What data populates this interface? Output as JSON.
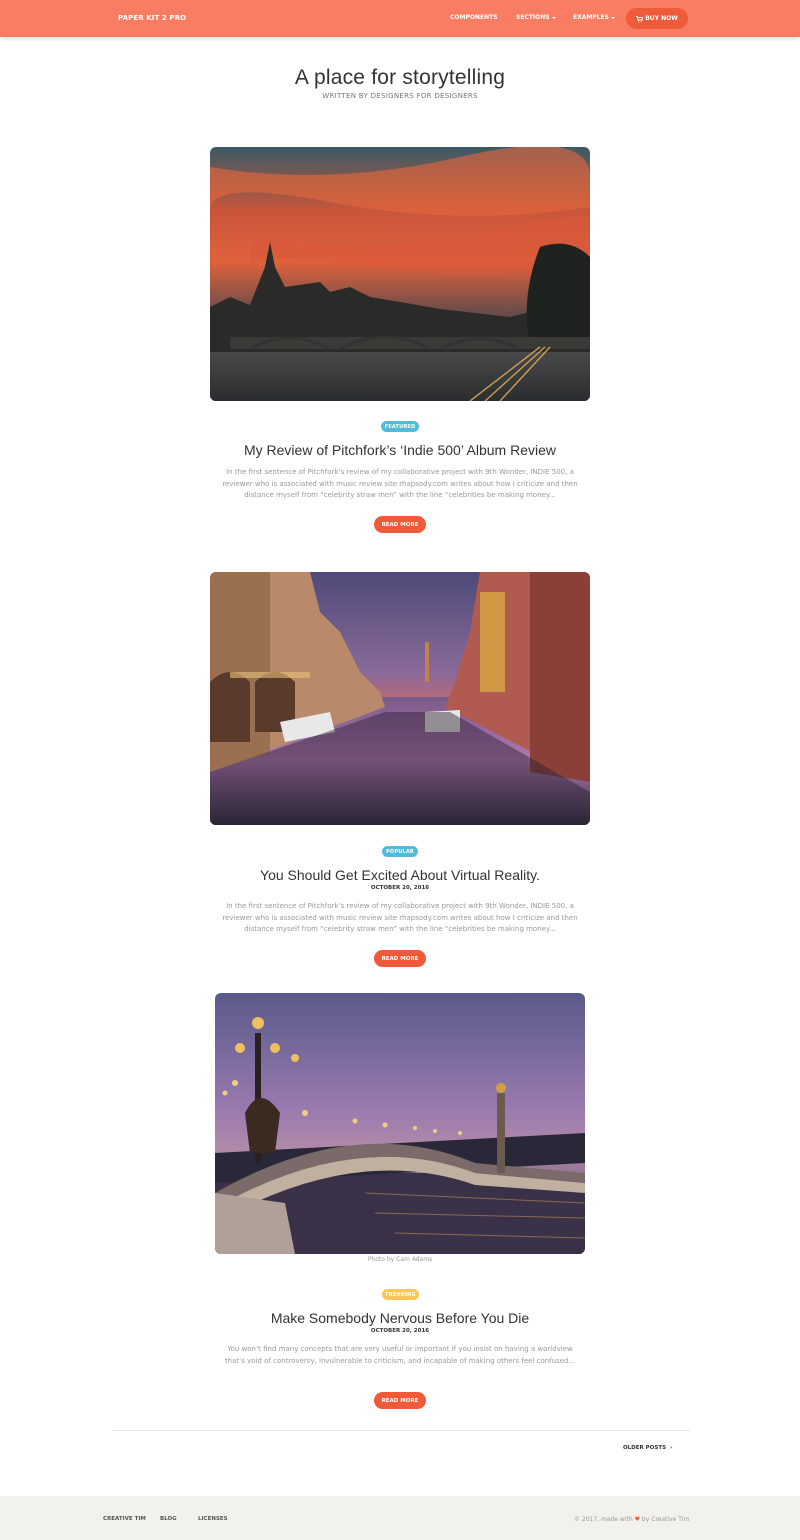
{
  "navbar": {
    "brand": "PAPER KIT 2 PRO",
    "components": "COMPONENTS",
    "sections": "SECTIONS",
    "examples": "EXAMPLES",
    "buy_now": "BUY NOW",
    "color": "#f87d62"
  },
  "header": {
    "title": "A place for storytelling",
    "subtitle": "WRITTEN BY DESIGNERS FOR DESIGNERS"
  },
  "articles": [
    {
      "image": "paris-sunset-bridge",
      "badge": "FEATURED",
      "title": "My Review of Pitchfork’s ‘Indie 500’ Album Review",
      "date": "",
      "description": "In the first sentence of Pitchfork’s review of my collaborative project with 9th Wonder, INDIE 500, a reviewer who is associated with music review site rhapsody.com writes about how I criticize and then distance myself from “celebrity straw men” with the line “celebrities be making money...",
      "button": "READ MORE"
    },
    {
      "image": "venice-canal-dusk",
      "badge": "POPULAR",
      "title": "You Should Get Excited About Virtual Reality.",
      "date": "OCTOBER 20, 2016",
      "description": "In the first sentence of Pitchfork’s review of my collaborative project with 9th Wonder, INDIE 500, a reviewer who is associated with music review site rhapsody.com writes about how I criticize and then distance myself from “celebrity straw men” with the line “celebrities be making money...",
      "button": "READ MORE"
    },
    {
      "image": "pont-alexandre-iii-night",
      "caption": "Photo by Cam Adams",
      "badge": "TRENDING",
      "title": "Make Somebody Nervous Before You Die",
      "date": "OCTOBER 20, 2016",
      "description": "You won’t find many concepts that are very useful or important if you insist on having a worldview that’s void of controversy, invulnerable to criticism, and incapable of making others feel confused...",
      "button": "READ MORE"
    }
  ],
  "pagination": {
    "older_posts": "OLDER POSTS",
    "chevron": "›"
  },
  "footer": {
    "links": [
      "CREATIVE TIM",
      "BLOG",
      "LICENSES"
    ],
    "copyright_prefix": "© 2017, made with",
    "heart": "♥",
    "copyright_suffix": "by Creative Tim"
  }
}
